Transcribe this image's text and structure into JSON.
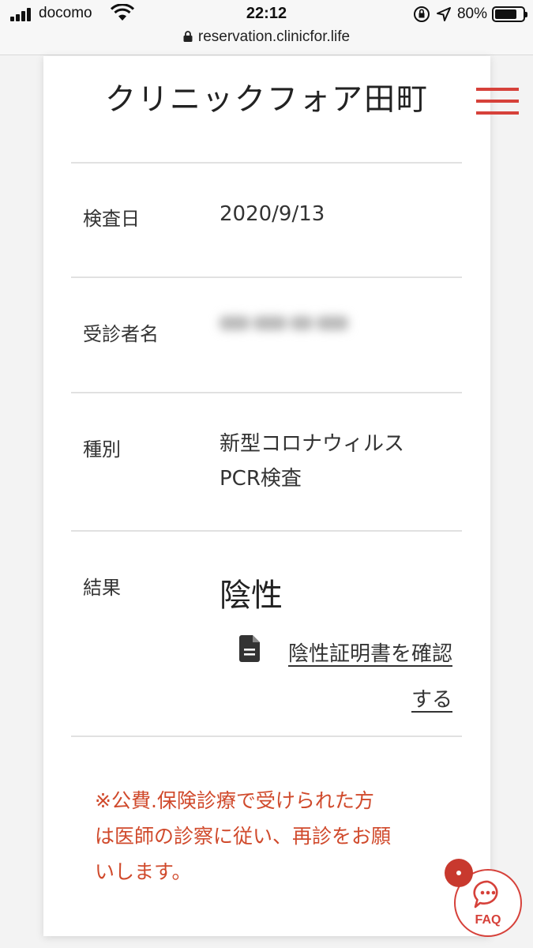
{
  "status_bar": {
    "carrier": "docomo",
    "time": "22:12",
    "battery_percent": "80%",
    "battery_level": 0.8,
    "icons": [
      "signal-icon",
      "wifi-icon",
      "orientation-lock-icon",
      "location-icon",
      "battery-icon"
    ]
  },
  "browser": {
    "url": "reservation.clinicfor.life"
  },
  "header": {
    "clinic_name": "クリニックフォア田町",
    "menu_icon": "hamburger-menu-icon"
  },
  "details": {
    "exam_date_label": "検査日",
    "exam_date_value": "2020/9/13",
    "patient_name_label": "受診者名",
    "type_label": "種別",
    "type_value_line1": "新型コロナウィルス",
    "type_value_line2": "PCR検査",
    "result_label": "結果",
    "result_value": "陰性"
  },
  "certificate_link": {
    "line1": "陰性証明書を確認",
    "line2": "する",
    "icon": "document-icon"
  },
  "notice": {
    "line1": "※公費.保険診療で受けられた方",
    "line2": "は医師の診察に従い、再診をお願",
    "line3": "いします。",
    "color": "#d04a2c"
  },
  "faq_button": {
    "label": "FAQ",
    "icon": "chat-bubble-icon",
    "accent": "#d6413a"
  }
}
